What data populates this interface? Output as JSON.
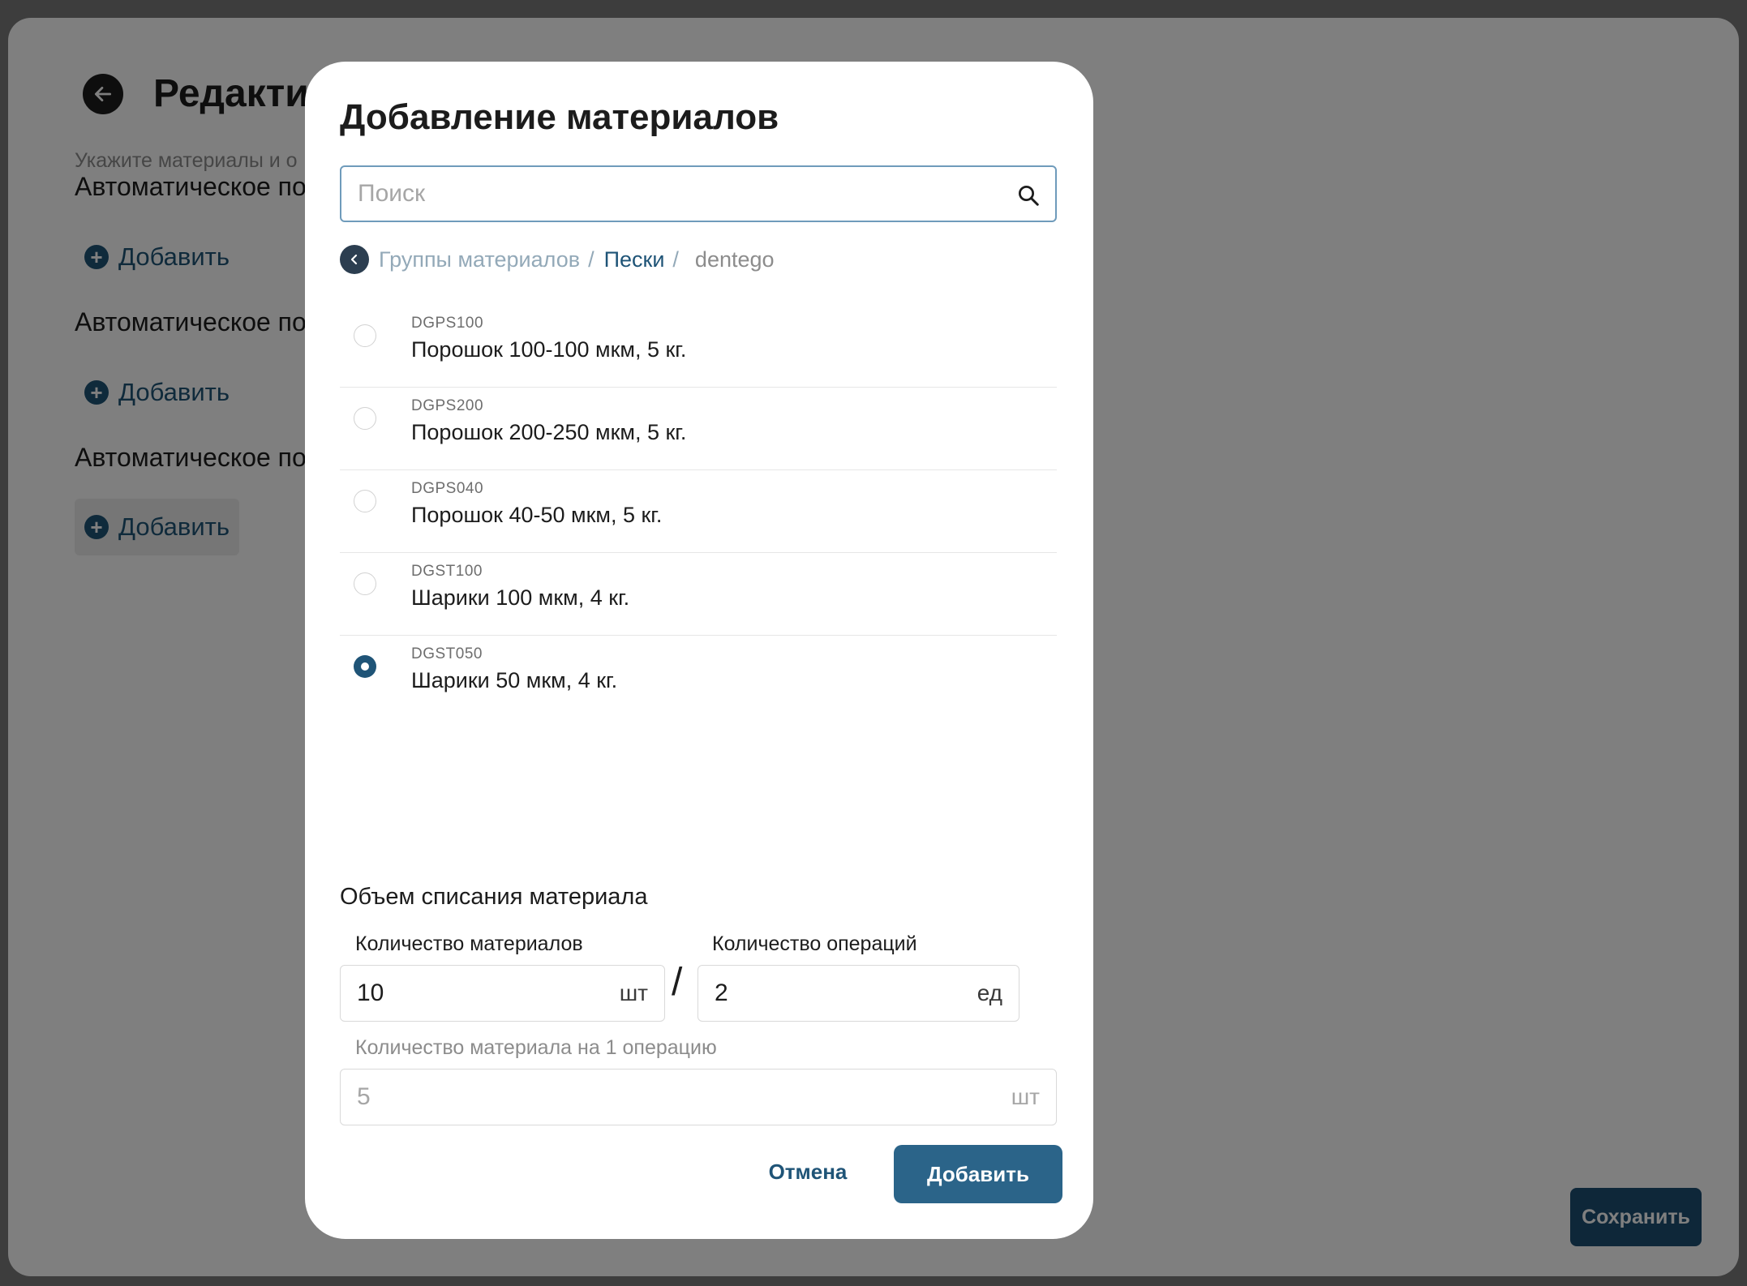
{
  "background": {
    "title": "Редактир",
    "subtitle": "Укажите материалы и о",
    "sections": [
      {
        "title": "Автоматическое по",
        "add_label": "Добавить"
      },
      {
        "title": "Автоматическое по",
        "add_label": "Добавить"
      },
      {
        "title": "Автоматическое по",
        "add_label": "Добавить"
      }
    ],
    "save_label": "Сохранить"
  },
  "modal": {
    "title": "Добавление материалов",
    "search": {
      "placeholder": "Поиск",
      "value": "",
      "icon": "search-icon"
    },
    "breadcrumb": {
      "back_icon": "chevron-left-icon",
      "items": [
        "Группы материалов",
        "Пески",
        "dentego"
      ],
      "separator": "/"
    },
    "materials": [
      {
        "code": "DGPS100",
        "name": "Порошок 100-100 мкм, 5 кг.",
        "selected": false
      },
      {
        "code": "DGPS200",
        "name": "Порошок 200-250 мкм, 5 кг.",
        "selected": false
      },
      {
        "code": "DGPS040",
        "name": "Порошок 40-50 мкм, 5 кг.",
        "selected": false
      },
      {
        "code": "DGST100",
        "name": "Шарики 100 мкм, 4 кг.",
        "selected": false
      },
      {
        "code": "DGST050",
        "name": "Шарики 50 мкм, 4 кг.",
        "selected": true
      }
    ],
    "volume_section": {
      "title": "Объем списания материала",
      "materials_qty": {
        "label": "Количество материалов",
        "value": "10",
        "unit": "шт"
      },
      "divider": "/",
      "operations_qty": {
        "label": "Количество операций",
        "value": "2",
        "unit": "ед"
      },
      "per_operation": {
        "label": "Количество материала на 1 операцию",
        "value": "5",
        "unit": "шт"
      }
    },
    "cancel_label": "Отмена",
    "add_label": "Добавить"
  },
  "colors": {
    "accent": "#1f5477",
    "button": "#2b6489",
    "overlay": "rgba(0,0,0,0.5)"
  }
}
